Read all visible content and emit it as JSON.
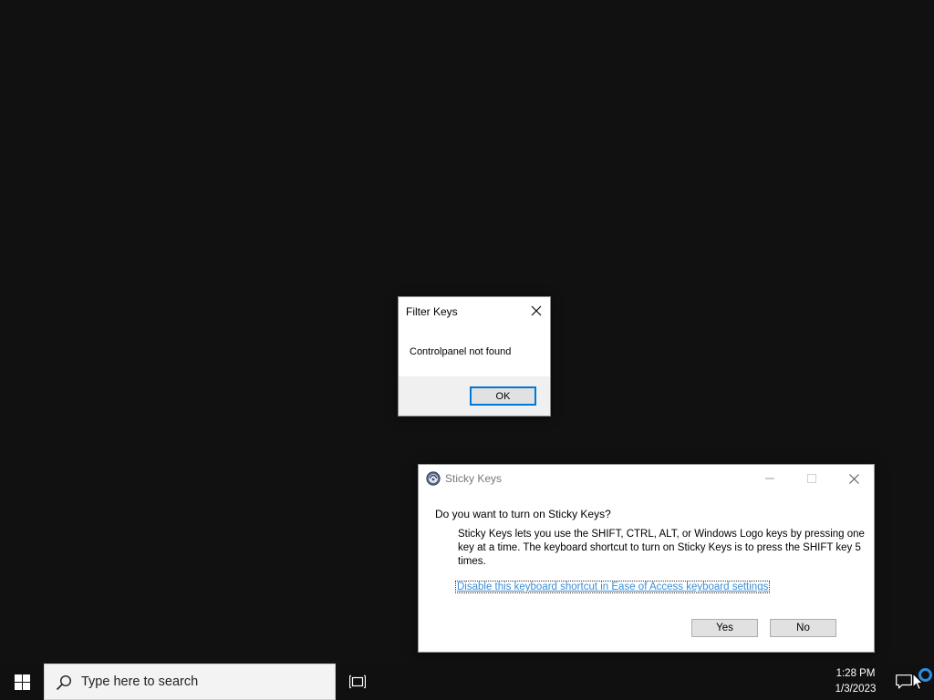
{
  "filter_keys_dialog": {
    "title": "Filter Keys",
    "message": "Controlpanel not found",
    "ok_label": "OK"
  },
  "sticky_keys_dialog": {
    "title": "Sticky Keys",
    "question": "Do you want to turn on Sticky Keys?",
    "description": "Sticky Keys lets you use the SHIFT, CTRL, ALT, or Windows Logo keys by pressing one key at a time. The keyboard shortcut to turn on Sticky Keys is to press the SHIFT key 5 times.",
    "link_text": "Disable this keyboard shortcut in Ease of Access keyboard settings",
    "yes_label": "Yes",
    "no_label": "No"
  },
  "taskbar": {
    "search_placeholder": "Type here to search",
    "time": "1:28 PM",
    "date": "1/3/2023"
  },
  "colors": {
    "desktop_background": "#111111",
    "taskbar_background": "#101010",
    "accent": "#0078d7",
    "link": "#3b8fd6"
  },
  "icons": {
    "start": "windows-logo-icon",
    "search": "search-icon",
    "task_view": "task-view-icon",
    "notifications": "notification-icon",
    "cortana": "cortana-ring-icon",
    "sticky_keys_app": "ease-of-access-icon",
    "cursor": "mouse-cursor-icon"
  }
}
